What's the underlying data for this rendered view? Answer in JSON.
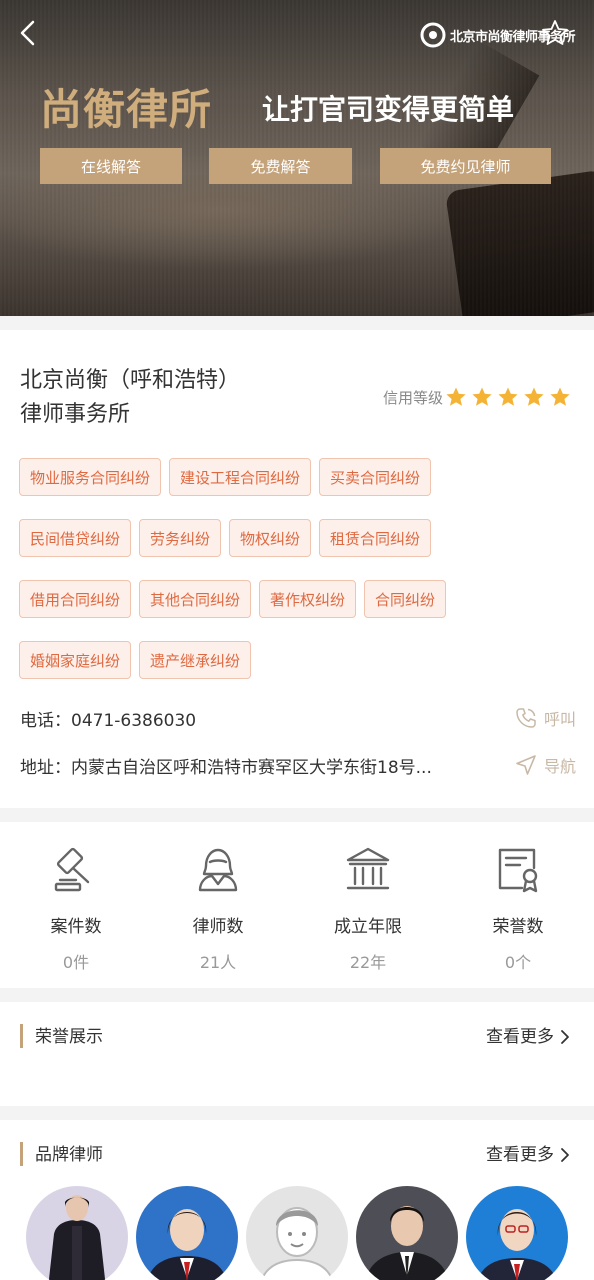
{
  "banner": {
    "logo_text": "北京市尚衡律师事务所",
    "title": "尚衡律所",
    "slogan": "让打官司变得更简单",
    "buttons": [
      "在线解答",
      "免费解答",
      "免费约见律师"
    ]
  },
  "firm": {
    "name": "北京尚衡（呼和浩特）律师事务所",
    "credit_label": "信用等级",
    "credit_stars": 5,
    "tag_rows": [
      [
        "物业服务合同纠纷",
        "建设工程合同纠纷",
        "买卖合同纠纷"
      ],
      [
        "民间借贷纠纷",
        "劳务纠纷",
        "物权纠纷",
        "租赁合同纠纷"
      ],
      [
        "借用合同纠纷",
        "其他合同纠纷",
        "著作权纠纷",
        "合同纠纷"
      ],
      [
        "婚姻家庭纠纷",
        "遗产继承纠纷"
      ]
    ],
    "phone": "电话：0471-6386030",
    "call_label": "呼叫",
    "address": "地址：内蒙古自治区呼和浩特市赛罕区大学东街18号...",
    "nav_label": "导航"
  },
  "stats": [
    {
      "name": "案件数",
      "value": "0件",
      "icon": "gavel-icon"
    },
    {
      "name": "律师数",
      "value": "21人",
      "icon": "lawyer-icon"
    },
    {
      "name": "成立年限",
      "value": "22年",
      "icon": "courthouse-icon"
    },
    {
      "name": "荣誉数",
      "value": "0个",
      "icon": "certificate-icon"
    }
  ],
  "honor": {
    "title": "荣誉展示",
    "more": "查看更多"
  },
  "lawyers": {
    "title": "品牌律师",
    "more": "查看更多",
    "count": 5
  },
  "colors": {
    "accent": "#c4a27a",
    "tag_text": "#df6a42",
    "tag_bg": "#fdf0ea",
    "star": "#f5b335"
  }
}
